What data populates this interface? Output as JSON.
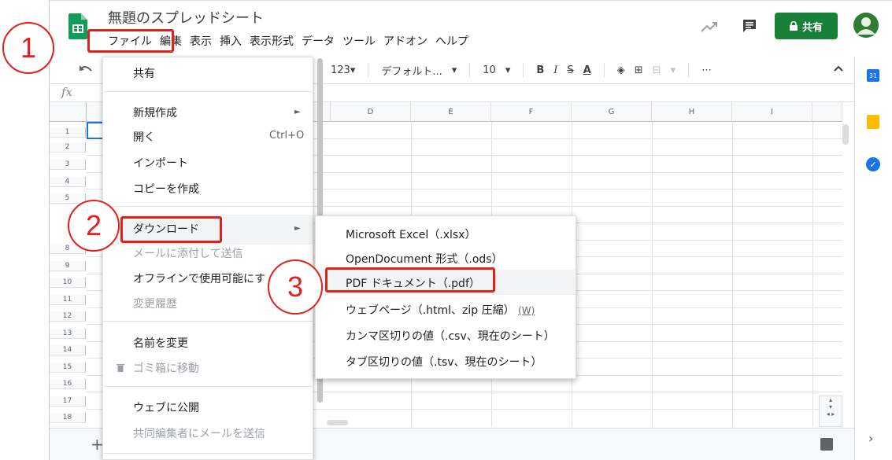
{
  "header": {
    "title": "無題のスプレッドシート",
    "share_label": "共有",
    "menus": [
      "ファイル",
      "編集",
      "表示",
      "挿入",
      "表示形式",
      "データ",
      "ツール",
      "アドオン",
      "ヘルプ"
    ]
  },
  "toolbar": {
    "format_number": "123▾",
    "font_name": "デフォルト...",
    "font_size": "10",
    "bold": "B",
    "italic": "I",
    "strike": "S",
    "text_color": "A",
    "more": "⋯",
    "fx": "fx"
  },
  "grid": {
    "columns": [
      "D",
      "E",
      "F",
      "G",
      "H",
      "I"
    ],
    "rows": [
      "1",
      "2",
      "3",
      "4",
      "5",
      "8",
      "9",
      "10",
      "11",
      "12",
      "13",
      "14",
      "15",
      "16",
      "17",
      "18"
    ]
  },
  "file_menu": {
    "share": "共有",
    "new": "新規作成",
    "open": "開く",
    "open_shortcut": "Ctrl+O",
    "import": "インポート",
    "copy": "コピーを作成",
    "download": "ダウンロード",
    "email_attach": "メールに添付して送信",
    "offline": "オフラインで使用可能にす",
    "history": "変更履歴",
    "rename": "名前を変更",
    "trash": "ゴミ箱に移動",
    "publish": "ウェブに公開",
    "email_collab": "共同編集者にメールを送信"
  },
  "download_menu": {
    "xlsx": "Microsoft Excel（.xlsx）",
    "ods": "OpenDocument 形式（.ods）",
    "pdf": "PDF ドキュメント（.pdf）",
    "html": "ウェブページ（.html、zip 圧縮）",
    "html_hint": "(W)",
    "csv": "カンマ区切りの値（.csv、現在のシート）",
    "tsv": "タブ区切りの値（.tsv、現在のシート）"
  },
  "annotations": {
    "step1": "1",
    "step2": "2",
    "step3": "3"
  },
  "colors": {
    "brand_green": "#188038",
    "annotation_red": "#e0211c"
  }
}
